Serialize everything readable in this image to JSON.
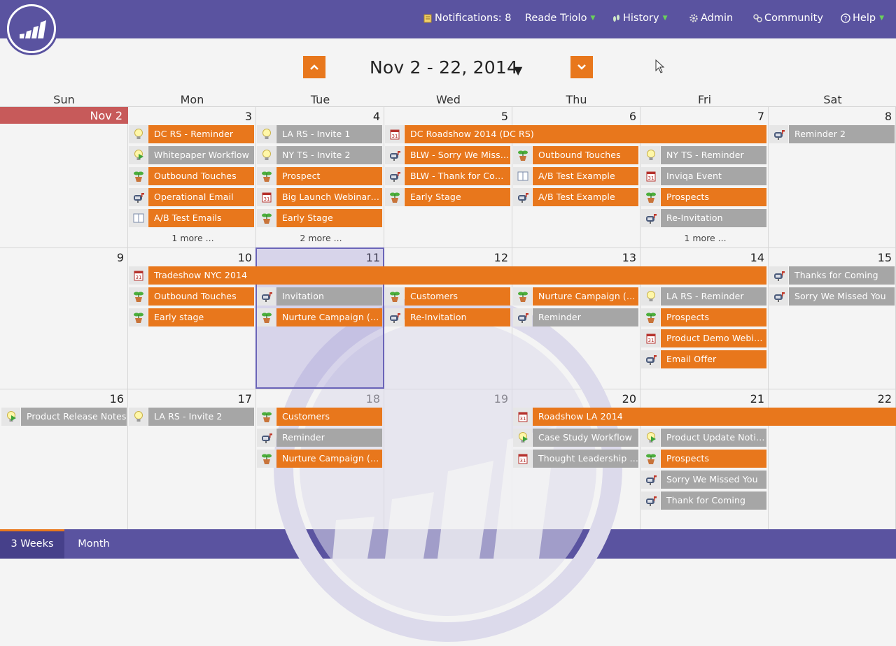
{
  "nav": {
    "notifications": "Notifications: 8",
    "user": "Reade Triolo",
    "history": "History",
    "admin": "Admin",
    "community": "Community",
    "help": "Help"
  },
  "calendar": {
    "range": "Nov 2 - 22, 2014",
    "day_headers": [
      "Sun",
      "Mon",
      "Tue",
      "Wed",
      "Thu",
      "Fri",
      "Sat"
    ],
    "today_label": "Nov 2",
    "day_numbers": [
      "3",
      "4",
      "5",
      "6",
      "7",
      "8",
      "9",
      "10",
      "11",
      "12",
      "13",
      "14",
      "15",
      "16",
      "17",
      "18",
      "19",
      "20",
      "21",
      "22"
    ],
    "more_labels": [
      "1 more ...",
      "2 more ...",
      "1 more ..."
    ]
  },
  "events": [
    {
      "label": "DC RS - Reminder",
      "color": "orange",
      "icon": "lightbulb-icon"
    },
    {
      "label": "Whitepaper Workflow",
      "color": "gray",
      "icon": "lightbulb-play-icon"
    },
    {
      "label": "Outbound Touches",
      "color": "orange",
      "icon": "plant-icon"
    },
    {
      "label": "Operational Email",
      "color": "orange",
      "icon": "mailbox-icon"
    },
    {
      "label": "A/B Test Emails",
      "color": "orange",
      "icon": "ab-test-icon"
    },
    {
      "label": "LA RS - Invite 1",
      "color": "gray",
      "icon": "lightbulb-icon"
    },
    {
      "label": "NY TS - Invite 2",
      "color": "gray",
      "icon": "lightbulb-icon"
    },
    {
      "label": "Prospect",
      "color": "orange",
      "icon": "plant-icon"
    },
    {
      "label": "Big Launch Webinar (...",
      "color": "orange",
      "icon": "event-icon"
    },
    {
      "label": "Early Stage",
      "color": "orange",
      "icon": "plant-icon"
    },
    {
      "label": "DC Roadshow 2014 (DC RS)",
      "color": "orange",
      "icon": "event-icon"
    },
    {
      "label": "BLW - Sorry We Misse...",
      "color": "orange",
      "icon": "mailbox-icon"
    },
    {
      "label": "BLW - Thank for Comi...",
      "color": "orange",
      "icon": "mailbox-icon"
    },
    {
      "label": "Early Stage",
      "color": "orange",
      "icon": "plant-icon"
    },
    {
      "label": "Outbound Touches",
      "color": "orange",
      "icon": "plant-icon"
    },
    {
      "label": "A/B Test Example",
      "color": "orange",
      "icon": "ab-test-icon"
    },
    {
      "label": "A/B Test Example",
      "color": "orange",
      "icon": "mailbox-icon"
    },
    {
      "label": "NY TS - Reminder",
      "color": "gray",
      "icon": "lightbulb-icon"
    },
    {
      "label": "Inviqa Event",
      "color": "gray",
      "icon": "event-icon"
    },
    {
      "label": "Prospects",
      "color": "orange",
      "icon": "plant-icon"
    },
    {
      "label": "Re-Invitation",
      "color": "gray",
      "icon": "mailbox-icon"
    },
    {
      "label": "Reminder 2",
      "color": "gray",
      "icon": "mailbox-icon"
    },
    {
      "label": "Tradeshow NYC 2014",
      "color": "orange",
      "icon": "event-icon"
    },
    {
      "label": "Outbound Touches",
      "color": "orange",
      "icon": "plant-icon"
    },
    {
      "label": "Early stage",
      "color": "orange",
      "icon": "plant-icon"
    },
    {
      "label": "Invitation",
      "color": "gray",
      "icon": "mailbox-icon"
    },
    {
      "label": "Nurture Campaign (Ru...",
      "color": "orange",
      "icon": "plant-icon"
    },
    {
      "label": "Customers",
      "color": "orange",
      "icon": "plant-icon"
    },
    {
      "label": "Re-Invitation",
      "color": "orange",
      "icon": "mailbox-icon"
    },
    {
      "label": "Nurture Campaign (Ru...",
      "color": "orange",
      "icon": "plant-icon"
    },
    {
      "label": "Reminder",
      "color": "gray",
      "icon": "mailbox-icon"
    },
    {
      "label": "LA RS - Reminder",
      "color": "gray",
      "icon": "lightbulb-icon"
    },
    {
      "label": "Prospects",
      "color": "orange",
      "icon": "plant-icon"
    },
    {
      "label": "Product Demo Webina...",
      "color": "orange",
      "icon": "event-icon"
    },
    {
      "label": "Email Offer",
      "color": "orange",
      "icon": "mailbox-icon"
    },
    {
      "label": "Thanks for Coming",
      "color": "gray",
      "icon": "mailbox-icon"
    },
    {
      "label": "Sorry We Missed You",
      "color": "gray",
      "icon": "mailbox-icon"
    },
    {
      "label": "Product Release Notes",
      "color": "gray",
      "icon": "lightbulb-play-icon"
    },
    {
      "label": "LA RS - Invite 2",
      "color": "gray",
      "icon": "lightbulb-icon"
    },
    {
      "label": "Customers",
      "color": "orange",
      "icon": "plant-icon"
    },
    {
      "label": "Reminder",
      "color": "gray",
      "icon": "mailbox-icon"
    },
    {
      "label": "Nurture Campaign (Ru...",
      "color": "orange",
      "icon": "plant-icon"
    },
    {
      "label": "Roadshow LA 2014",
      "color": "orange",
      "icon": "event-icon"
    },
    {
      "label": "Case Study Workflow",
      "color": "gray",
      "icon": "lightbulb-play-icon"
    },
    {
      "label": "Thought Leadership W...",
      "color": "gray",
      "icon": "event-icon"
    },
    {
      "label": "Product Update Notific...",
      "color": "gray",
      "icon": "lightbulb-play-icon"
    },
    {
      "label": "Prospects",
      "color": "orange",
      "icon": "plant-icon"
    },
    {
      "label": "Sorry We Missed You",
      "color": "gray",
      "icon": "mailbox-icon"
    },
    {
      "label": "Thank for Coming",
      "color": "gray",
      "icon": "mailbox-icon"
    }
  ],
  "footer": {
    "tabs": [
      "3 Weeks",
      "Month"
    ]
  },
  "colors": {
    "header_bg": "#5a53a0",
    "orange": "#e8771c",
    "gray": "#a6a6a6",
    "today": "#c75a5a"
  }
}
